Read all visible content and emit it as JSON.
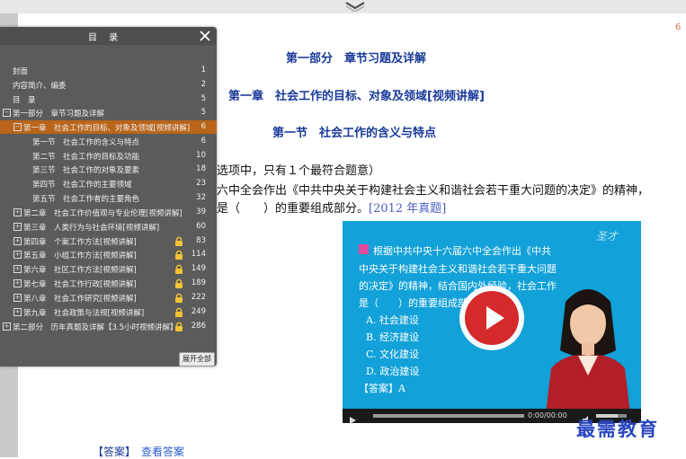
{
  "page": {
    "number": "6",
    "part_heading": "第一部分　章节习题及详解",
    "chapter_heading": "第一章　社会工作的目标、对象及领域[视频讲解]",
    "section_heading": "第一节　社会工作的含义与特点",
    "question_line1": "选项中，只有１个最符合题意）",
    "question_line2": "六中全会作出《中共中央关于构建社会主义和谐社会若干重大问题的决定》的精神，",
    "question_line3": "是（　　）的重要组成部分。",
    "question_year": "[2012 年真题]",
    "answer_label": "【答案】",
    "answer_link": "查看答案"
  },
  "toc": {
    "title": "目 录",
    "expand_all": "展开全部",
    "items": [
      {
        "label": "封面",
        "page": "1"
      },
      {
        "label": "内容简介、编委",
        "page": "2"
      },
      {
        "label": "目　录",
        "page": "5"
      },
      {
        "label": "第一部分　章节习题及详解",
        "page": "5",
        "toggle": "−"
      },
      {
        "label": "第一章　社会工作的目标、对象及领域[视频讲解]",
        "page": "6",
        "toggle": "−"
      },
      {
        "label": "第一节　社会工作的含义与特点",
        "page": "6"
      },
      {
        "label": "第二节　社会工作的目标及功能",
        "page": "10"
      },
      {
        "label": "第三节　社会工作的对象及要素",
        "page": "18"
      },
      {
        "label": "第四节　社会工作的主要领域",
        "page": "23"
      },
      {
        "label": "第五节　社会工作者的主要角色",
        "page": "32"
      },
      {
        "label": "第二章　社会工作价值观与专业伦理[视频讲解]",
        "page": "39",
        "toggle": "+"
      },
      {
        "label": "第三章　人类行为与社会环境[视频讲解]",
        "page": "60",
        "toggle": "+"
      },
      {
        "label": "第四章　个案工作方法[视频讲解]",
        "page": "83",
        "toggle": "+"
      },
      {
        "label": "第五章　小组工作方法[视频讲解]",
        "page": "114",
        "toggle": "+"
      },
      {
        "label": "第六章　社区工作方法[视频讲解]",
        "page": "149",
        "toggle": "+"
      },
      {
        "label": "第七章　社会工作行政[视频讲解]",
        "page": "189",
        "toggle": "+"
      },
      {
        "label": "第八章　社会工作研究[视频讲解]",
        "page": "222",
        "toggle": "+"
      },
      {
        "label": "第九章　社会政策与法规[视频讲解]",
        "page": "249",
        "toggle": "+"
      },
      {
        "label": "第二部分　历年真题及详解【3.5小时视频讲解】",
        "page": "286",
        "toggle": "+"
      }
    ]
  },
  "video": {
    "logo": "圣才",
    "line1": "根据中共中央十六届六中全会作出《中共",
    "line2": "中央关于构建社会主义和谐社会若干重大问题",
    "line3": "的决定》的精神，结合国内外经验，社会工作",
    "line4": "是（　　）的重要组成部分。",
    "options": [
      "A.  社会建设",
      "B.  经济建设",
      "C.  文化建设",
      "D.  政治建设"
    ],
    "answer": "【答案】A",
    "time": "0:00/00:00",
    "progress": 0,
    "volume": 0.7
  },
  "watermark": "最需教育",
  "colors": {
    "heading": "#1a3a9a",
    "toc_bg": "#5b5b5b",
    "toc_active": "#b9651a",
    "video_bg": "#12a1d8",
    "play_red": "#dc2626"
  }
}
